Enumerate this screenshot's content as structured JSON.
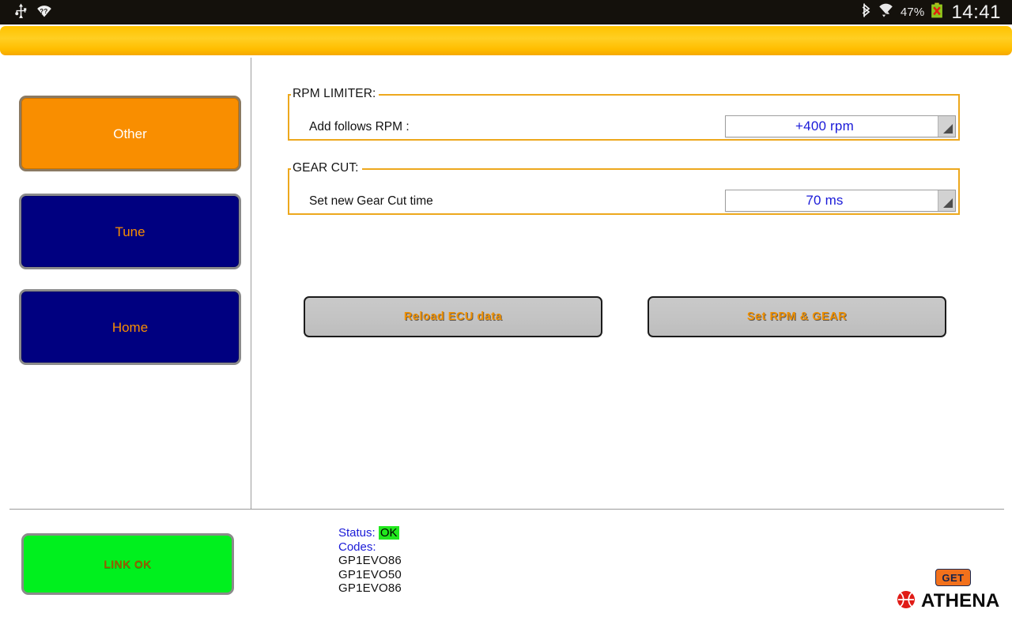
{
  "statusbar": {
    "left_icons": [
      "usb-icon",
      "wifi-unknown-icon"
    ],
    "right_icons": [
      "bluetooth-icon",
      "wifi-transfer-icon",
      "battery-error-icon"
    ],
    "battery_percent": "47%",
    "clock": "14:41"
  },
  "titlebar": {
    "title": "",
    "color": "#ffc200"
  },
  "sidebar": {
    "items": [
      {
        "label": "Other",
        "bg": "#f98e00",
        "fg": "#ffffff",
        "name": "sidebar-item-other"
      },
      {
        "label": "Tune",
        "bg": "#000080",
        "fg": "#f98e00",
        "name": "sidebar-item-tune"
      },
      {
        "label": "Home",
        "bg": "#000080",
        "fg": "#f98e00",
        "name": "sidebar-item-home"
      }
    ],
    "link_button": {
      "label": "LINK OK",
      "bg": "#00f01e",
      "fg": "#9a5a00"
    }
  },
  "main": {
    "groups": [
      {
        "legend": "RPM LIMITER:",
        "field_label": "Add follows RPM :",
        "combo_value": "+400 rpm",
        "combo_options": [
          "+400 rpm"
        ]
      },
      {
        "legend": "GEAR CUT:",
        "field_label": "Set new Gear Cut time",
        "combo_value": "70 ms",
        "combo_options": [
          "70 ms"
        ]
      }
    ],
    "buttons": [
      {
        "label": "Reload ECU data"
      },
      {
        "label": "Set RPM & GEAR"
      }
    ]
  },
  "footer": {
    "status_key": "Status:",
    "status_value": "OK",
    "codes_key": "Codes:",
    "codes": [
      "GP1EVO86",
      "GP1EVO50",
      "GP1EVO86"
    ],
    "brand_badge": "GET",
    "brand_name": "ATHENA",
    "brand_colors": {
      "badge_bg": "#f2711c",
      "badge_fg": "#16224a",
      "mark": "#e01b16"
    }
  }
}
